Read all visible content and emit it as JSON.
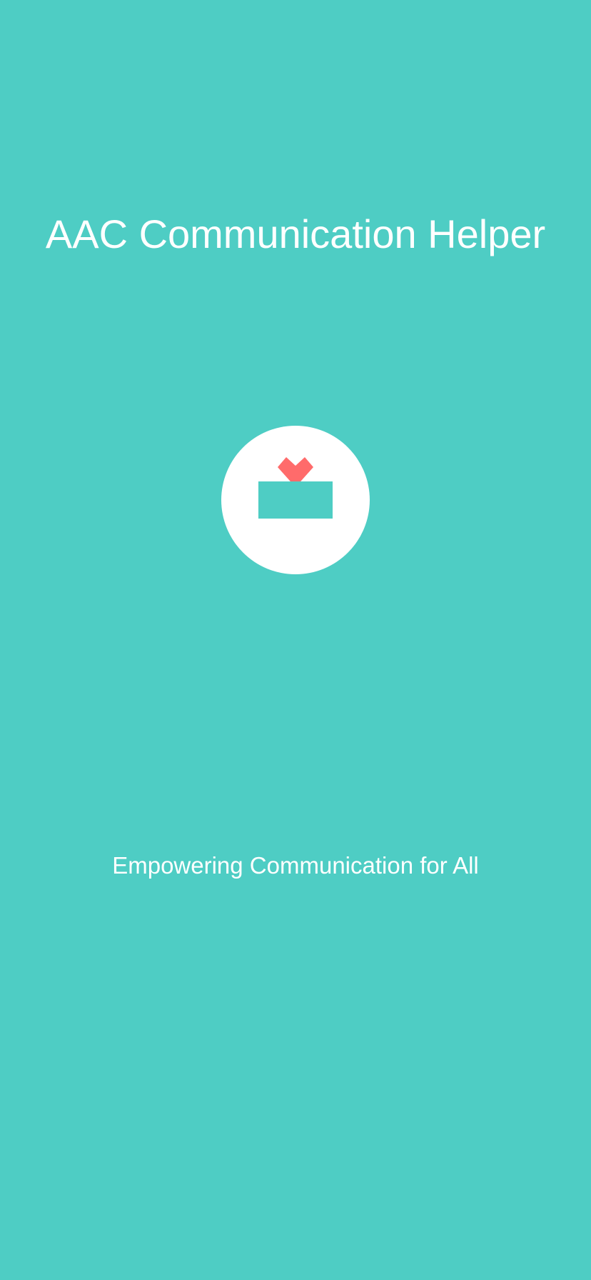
{
  "splash": {
    "title": "AAC Communication Helper",
    "tagline": "Empowering Communication for All"
  },
  "colors": {
    "background": "#4ecdc4",
    "text": "#ffffff",
    "logo_circle": "#ffffff",
    "heart": "#ff6b6b",
    "speech_box": "#4ecdc4"
  },
  "icons": {
    "logo": "heart-over-speech-box-logo",
    "heart": "heart-icon",
    "speech_box": "speech-box-icon"
  }
}
